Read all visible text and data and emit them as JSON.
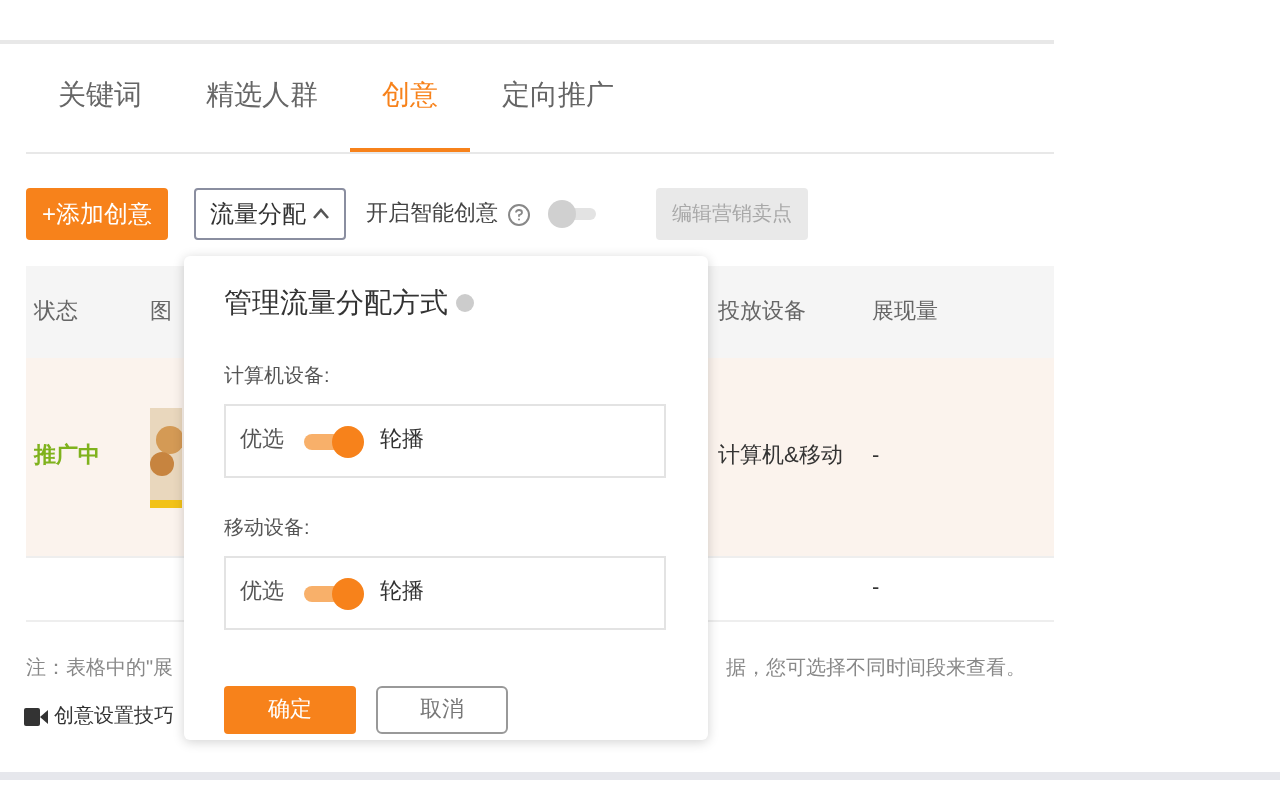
{
  "tabs": [
    {
      "label": "关键词",
      "selected": false
    },
    {
      "label": "精选人群",
      "selected": false
    },
    {
      "label": "创意",
      "selected": true
    },
    {
      "label": "定向推广",
      "selected": false
    }
  ],
  "toolbar": {
    "add_button": "+添加创意",
    "traffic_dropdown": {
      "label": "流量分配",
      "expanded": true
    },
    "smart_creative": {
      "label": "开启智能创意",
      "on": false
    },
    "disabled_button": {
      "label": "编辑营销卖点",
      "disabled": true
    }
  },
  "table": {
    "columns": [
      "状态",
      "图",
      "投放设备",
      "展现量"
    ],
    "rows": [
      {
        "status": "推广中",
        "device": "计算机&移动",
        "impressions": "-",
        "highlighted": true
      },
      {
        "status": "",
        "device": "",
        "impressions": "-",
        "highlighted": false
      }
    ]
  },
  "note": {
    "start": "注：表格中的\"展",
    "end": "据，您可选择不同时间段来查看。"
  },
  "tips_link": "创意设置技巧",
  "popup": {
    "title": "管理流量分配方式",
    "sections": [
      {
        "label": "计算机设备:",
        "left": "优选",
        "right": "轮播",
        "on": true
      },
      {
        "label": "移动设备:",
        "left": "优选",
        "right": "轮播",
        "on": true
      }
    ],
    "confirm": "确定",
    "cancel": "取消"
  }
}
